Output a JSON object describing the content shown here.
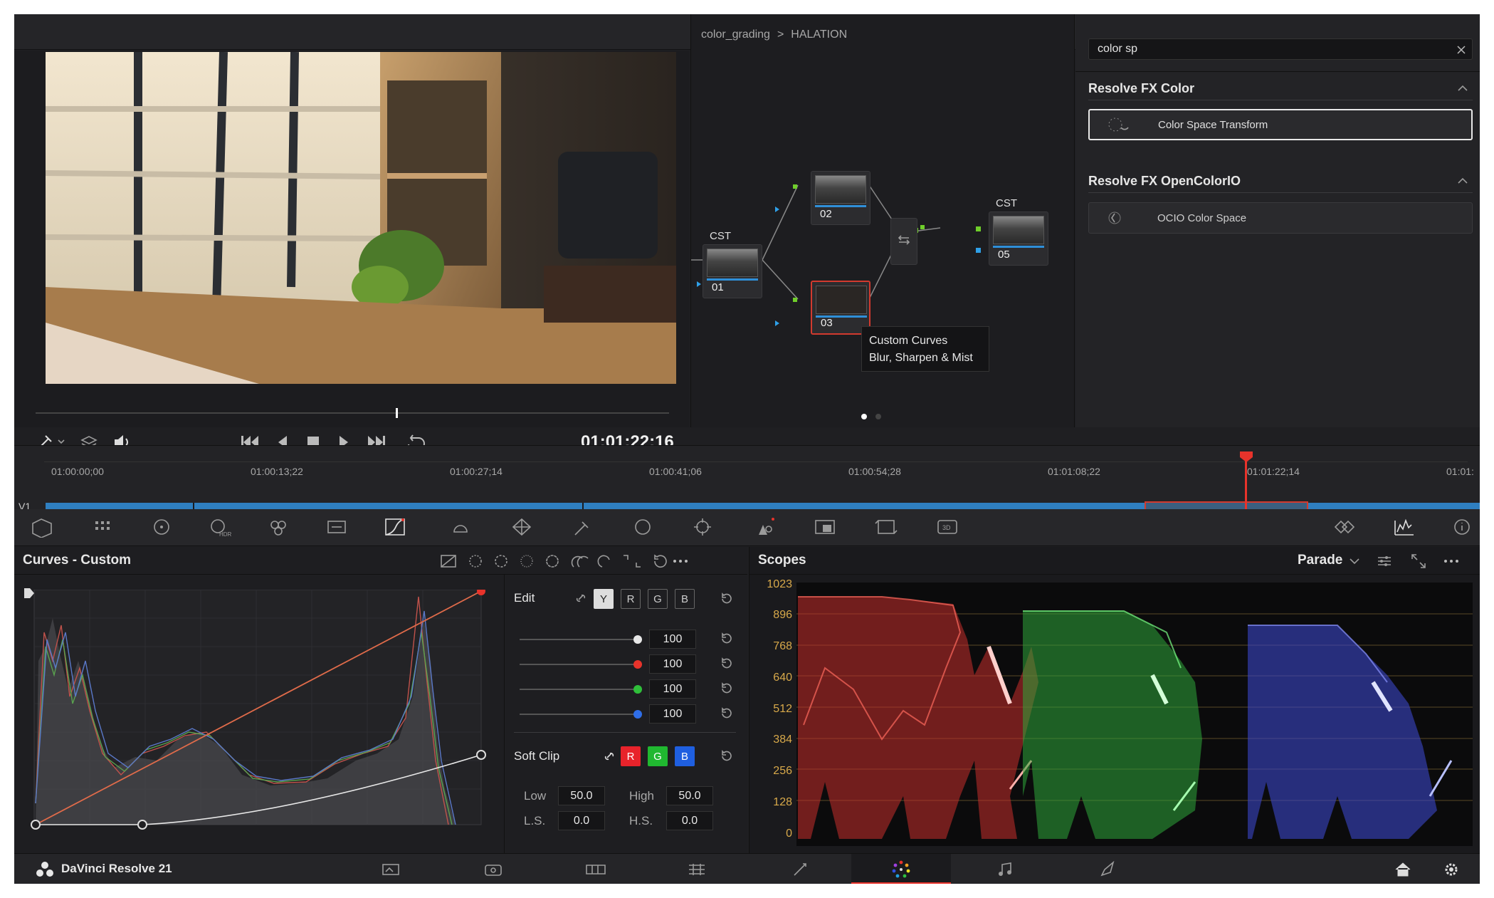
{
  "node_editor": {
    "breadcrumb_root": "color_grading",
    "breadcrumb_sep": ">",
    "breadcrumb_current": "HALATION",
    "nodes": [
      {
        "num": "01",
        "label": "CST"
      },
      {
        "num": "02",
        "label": ""
      },
      {
        "num": "03",
        "label": ""
      },
      {
        "num": "05",
        "label": "CST"
      }
    ],
    "tooltip_line1": "Custom Curves",
    "tooltip_line2": "Blur, Sharpen & Mist"
  },
  "fx_library": {
    "search_value": "color sp",
    "group1_title": "Resolve FX Color",
    "group1_item": "Color Space Transform",
    "group2_title": "Resolve FX OpenColorIO",
    "group2_item": "OCIO Color Space"
  },
  "viewer": {
    "timecode": "01:01:22;16"
  },
  "timeline": {
    "ruler": [
      "01:00:00;00",
      "01:00:13;22",
      "01:00:27;14",
      "01:00:41;06",
      "01:00:54;28",
      "01:01:08;22",
      "01:01:22;14",
      "01:01:"
    ],
    "track_label": "V1"
  },
  "curves": {
    "title": "Curves - Custom",
    "edit_label": "Edit",
    "channels": [
      "Y",
      "R",
      "G",
      "B"
    ],
    "intensities": [
      "100",
      "100",
      "100",
      "100"
    ],
    "soft_clip_label": "Soft Clip",
    "soft_clip_channels": [
      "R",
      "G",
      "B"
    ],
    "low_label": "Low",
    "low_value": "50.0",
    "high_label": "High",
    "high_value": "50.0",
    "ls_label": "L.S.",
    "ls_value": "0.0",
    "hs_label": "H.S.",
    "hs_value": "0.0"
  },
  "scopes": {
    "title": "Scopes",
    "mode": "Parade",
    "scale": [
      "1023",
      "896",
      "768",
      "640",
      "512",
      "384",
      "256",
      "128",
      "0"
    ]
  },
  "app": {
    "name": "DaVinci Resolve 21"
  },
  "colors": {
    "accent_red": "#e8332b",
    "timeline_clip": "#2f7fc0",
    "scope_scale": "#d8a94a"
  }
}
